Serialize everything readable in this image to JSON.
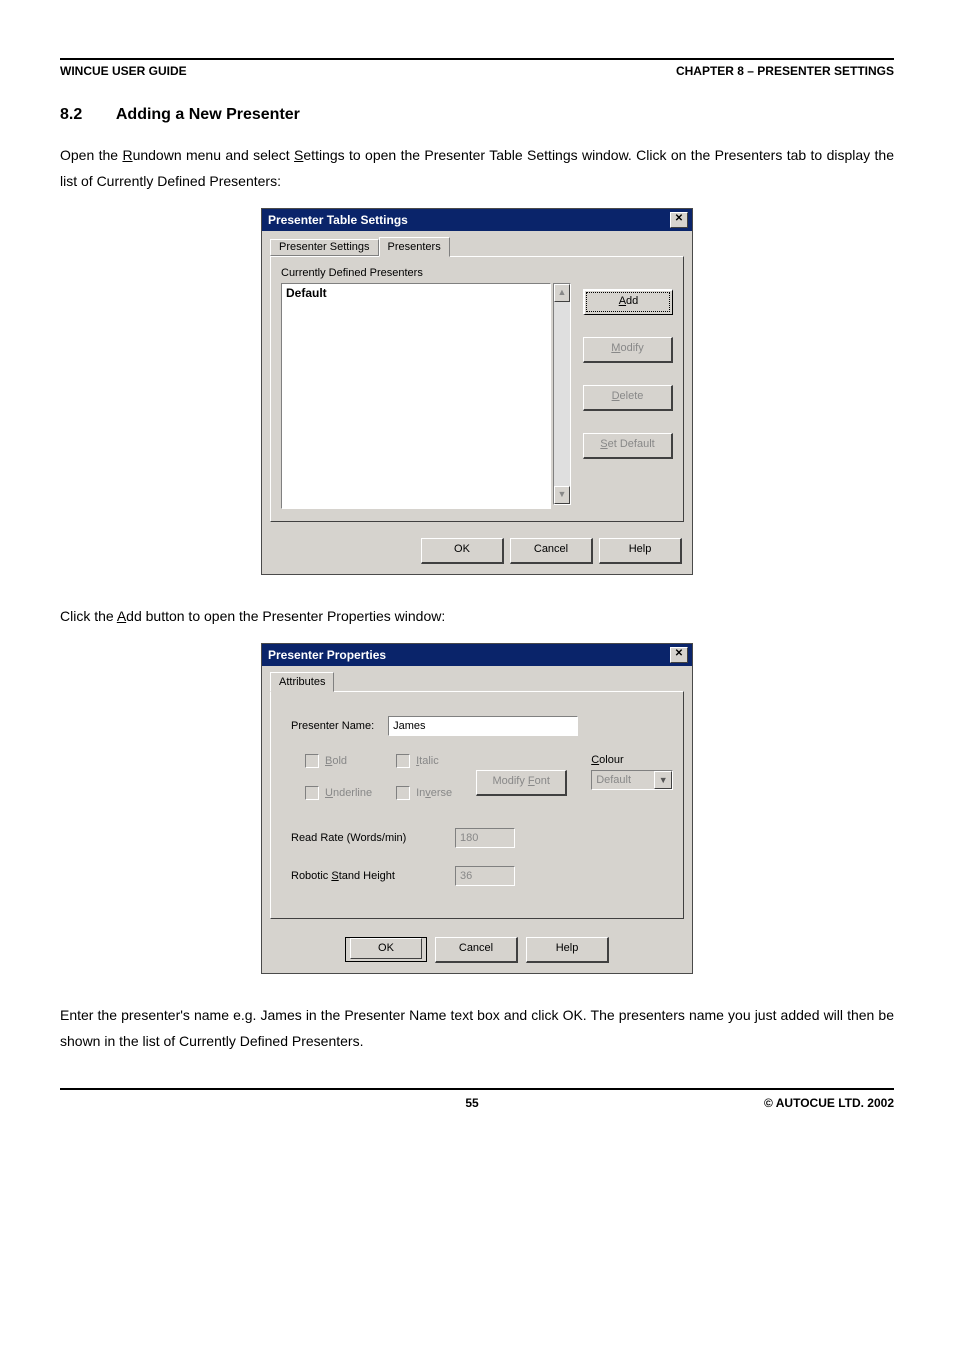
{
  "header": {
    "left": "WINCUE USER GUIDE",
    "right": "CHAPTER 8 – PRESENTER SETTINGS"
  },
  "section": {
    "number": "8.2",
    "title": "Adding a New Presenter"
  },
  "para1a": "Open the ",
  "para1_r": "R",
  "para1b": "undown menu and select ",
  "para1_s": "S",
  "para1c": "ettings to open the Presenter Table Settings window. Click on the Presenters tab to display the list of Currently Defined Presenters:",
  "dialog1": {
    "title": "Presenter Table Settings",
    "tab1": "Presenter Settings",
    "tab2": "Presenters",
    "groupLabel": "Currently Defined Presenters",
    "listItem": "Default",
    "buttons": {
      "add_pre": "A",
      "add_post": "dd",
      "modify_pre": "M",
      "modify_post": "odify",
      "delete_pre": "D",
      "delete_post": "elete",
      "setdefault_pre": "S",
      "setdefault_post": "et Default"
    },
    "footer": {
      "ok": "OK",
      "cancel": "Cancel",
      "help": "Help"
    }
  },
  "para2a": "Click the ",
  "para2_a": "A",
  "para2b": "dd button to open the Presenter Properties window:",
  "dialog2": {
    "title": "Presenter Properties",
    "tab": "Attributes",
    "presenterNameLabel": "Presenter Name:",
    "presenterNameValue": "James",
    "bold_pre": "B",
    "bold_post": "old",
    "italic_pre": "I",
    "italic_post": "talic",
    "underline_pre": "U",
    "underline_post": "nderline",
    "inverse_pre": "",
    "inverse_mid": "v",
    "inverse_pre2": "In",
    "inverse_post": "erse",
    "modifyFont_pre": "Modify ",
    "modifyFont_u": "F",
    "modifyFont_post": "ont",
    "colour_pre": "C",
    "colour_post": "olour",
    "colourValue": "Default",
    "readRateLabel": "Read Rate (Words/min)",
    "readRateValue": "180",
    "standHeight_pre": "Robotic ",
    "standHeight_u": "S",
    "standHeight_post": "tand Height",
    "standHeightValue": "36",
    "footer": {
      "ok": "OK",
      "cancel": "Cancel",
      "help": "Help"
    }
  },
  "para3": "Enter the presenter's name e.g. James in the Presenter Name text box and click OK. The presenters name you just added will then be shown in the list of Currently Defined Presenters.",
  "footer": {
    "page": "55",
    "copyright": "© AUTOCUE  LTD.  2002"
  }
}
